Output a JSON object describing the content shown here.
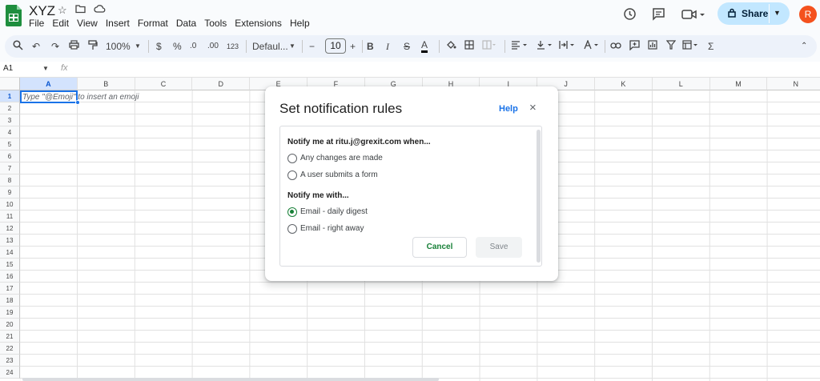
{
  "app": {
    "doc_title": "XYZ",
    "menus": [
      "File",
      "Edit",
      "View",
      "Insert",
      "Format",
      "Data",
      "Tools",
      "Extensions",
      "Help"
    ]
  },
  "header": {
    "share_label": "Share",
    "avatar_initial": "R"
  },
  "toolbar": {
    "zoom": "100%",
    "currency": "$",
    "percent": "%",
    "decimal_decrease": ".0",
    "decimal_increase": ".00",
    "number_format": "123",
    "font": "Defaul...",
    "font_size": "10",
    "minus": "−",
    "plus": "+",
    "bold": "B",
    "italic": "I",
    "strike": "S",
    "text_color": "A",
    "sigma": "Σ"
  },
  "formula": {
    "name_box": "A1",
    "fx": "fx"
  },
  "sheet": {
    "columns": [
      "A",
      "B",
      "C",
      "D",
      "E",
      "F",
      "G",
      "H",
      "I",
      "J",
      "K",
      "L",
      "M",
      "N"
    ],
    "rows": [
      "1",
      "2",
      "3",
      "4",
      "5",
      "6",
      "7",
      "8",
      "9",
      "10",
      "11",
      "12",
      "13",
      "14",
      "15",
      "16",
      "17",
      "18",
      "19",
      "20",
      "21",
      "22",
      "23",
      "24"
    ],
    "cell_hint": "Type \"@Emoji\" to insert an emoji"
  },
  "dialog": {
    "title": "Set notification rules",
    "help": "Help",
    "close": "×",
    "section1": "Notify me at ritu.j@grexit.com when...",
    "options1": [
      "Any changes are made",
      "A user submits a form"
    ],
    "section2": "Notify me with...",
    "options2": [
      "Email - daily digest",
      "Email - right away"
    ],
    "selected_option2": "Email - daily digest",
    "cancel": "Cancel",
    "save": "Save"
  },
  "colors": {
    "share_bg": "#c2e7ff",
    "selection_blue": "#1a73e8",
    "radio_green": "#188038",
    "avatar": "#f4511e"
  }
}
